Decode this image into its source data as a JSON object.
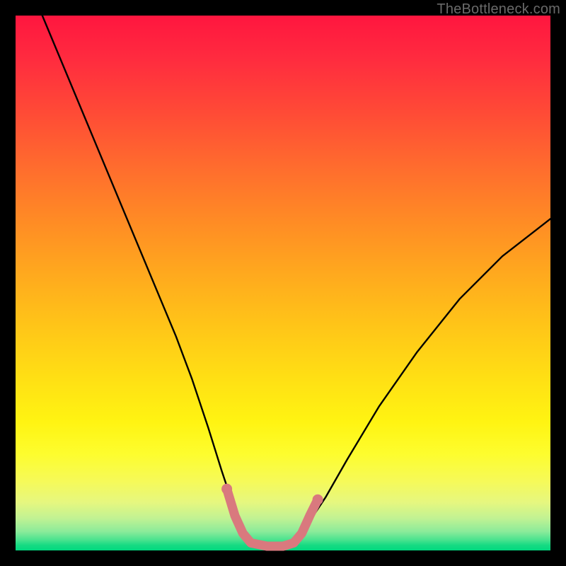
{
  "watermark": "TheBottleneck.com",
  "chart_data": {
    "type": "line",
    "title": "",
    "xlabel": "",
    "ylabel": "",
    "xlim": [
      0,
      100
    ],
    "ylim": [
      0,
      100
    ],
    "grid": false,
    "legend": false,
    "series": [
      {
        "name": "black-curve",
        "color": "#000000",
        "x": [
          5,
          10,
          15,
          20,
          25,
          30,
          33,
          36,
          38.5,
          40.5,
          42,
          43.5,
          47,
          50,
          52,
          55,
          58,
          62,
          68,
          75,
          83,
          91,
          100
        ],
        "values": [
          100,
          88,
          76,
          64,
          52,
          40,
          32,
          23,
          15,
          9,
          4.5,
          2.2,
          0.8,
          0.8,
          2.2,
          5.5,
          10,
          17,
          27,
          37,
          47,
          55,
          62
        ]
      },
      {
        "name": "pink-flat-segment",
        "color": "#d9797e",
        "x": [
          39.5,
          41,
          42.5,
          44,
          47,
          50,
          52,
          53.5,
          55,
          56.5
        ],
        "values": [
          11.5,
          6.5,
          3.2,
          1.4,
          0.8,
          0.8,
          1.4,
          3.2,
          6.5,
          9.5
        ]
      }
    ],
    "annotations": []
  },
  "colors": {
    "background": "#000000",
    "gradient_top": "#ff163f",
    "gradient_bottom": "#00d87f",
    "curve": "#000000",
    "flat_marker": "#d9797e",
    "watermark": "#6a6a6a"
  }
}
